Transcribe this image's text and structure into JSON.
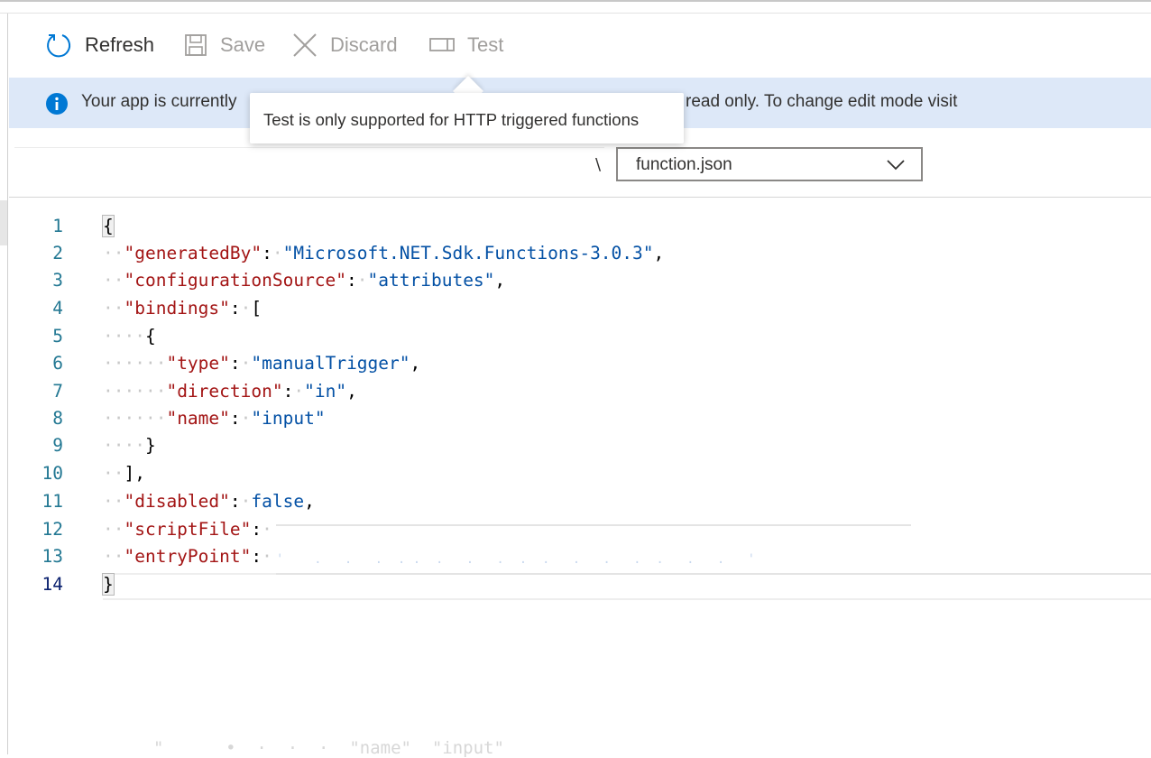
{
  "toolbar": {
    "refresh_label": "Refresh",
    "save_label": "Save",
    "discard_label": "Discard",
    "test_label": "Test"
  },
  "banner": {
    "text_left": "Your app is currently",
    "text_right": "read only. To change edit mode visit"
  },
  "tooltip": {
    "text": "Test is only supported for HTTP triggered functions"
  },
  "file_selector": {
    "path_separator": "\\",
    "selected": "function.json"
  },
  "editor": {
    "line_numbers": [
      "1",
      "2",
      "3",
      "4",
      "5",
      "6",
      "7",
      "8",
      "9",
      "10",
      "11",
      "12",
      "13",
      "14"
    ],
    "active_line": 14,
    "lines": {
      "l1": "{",
      "l2_key": "\"generatedBy\"",
      "l2_val": "\"Microsoft.NET.Sdk.Functions-3.0.3\"",
      "l3_key": "\"configurationSource\"",
      "l3_val": "\"attributes\"",
      "l4_key": "\"bindings\"",
      "l4_open": "[",
      "l5": "{",
      "l6_key": "\"type\"",
      "l6_val": "\"manualTrigger\"",
      "l7_key": "\"direction\"",
      "l7_val": "\"in\"",
      "l8_key": "\"name\"",
      "l8_val": "\"input\"",
      "l9": "}",
      "l10": "],",
      "l11_key": "\"disabled\"",
      "l11_val": "false",
      "l12_key": "\"scriptFile\"",
      "l13_key": "\"entryPoint\"",
      "l14": "}"
    }
  },
  "colors": {
    "banner_bg": "#dde8f8",
    "info_icon": "#0078d4",
    "json_key": "#a31515",
    "json_string": "#0451a5",
    "line_number": "#237893"
  },
  "icons": [
    "refresh-icon",
    "save-icon",
    "discard-icon",
    "test-icon",
    "info-icon",
    "chevron-down-icon"
  ]
}
